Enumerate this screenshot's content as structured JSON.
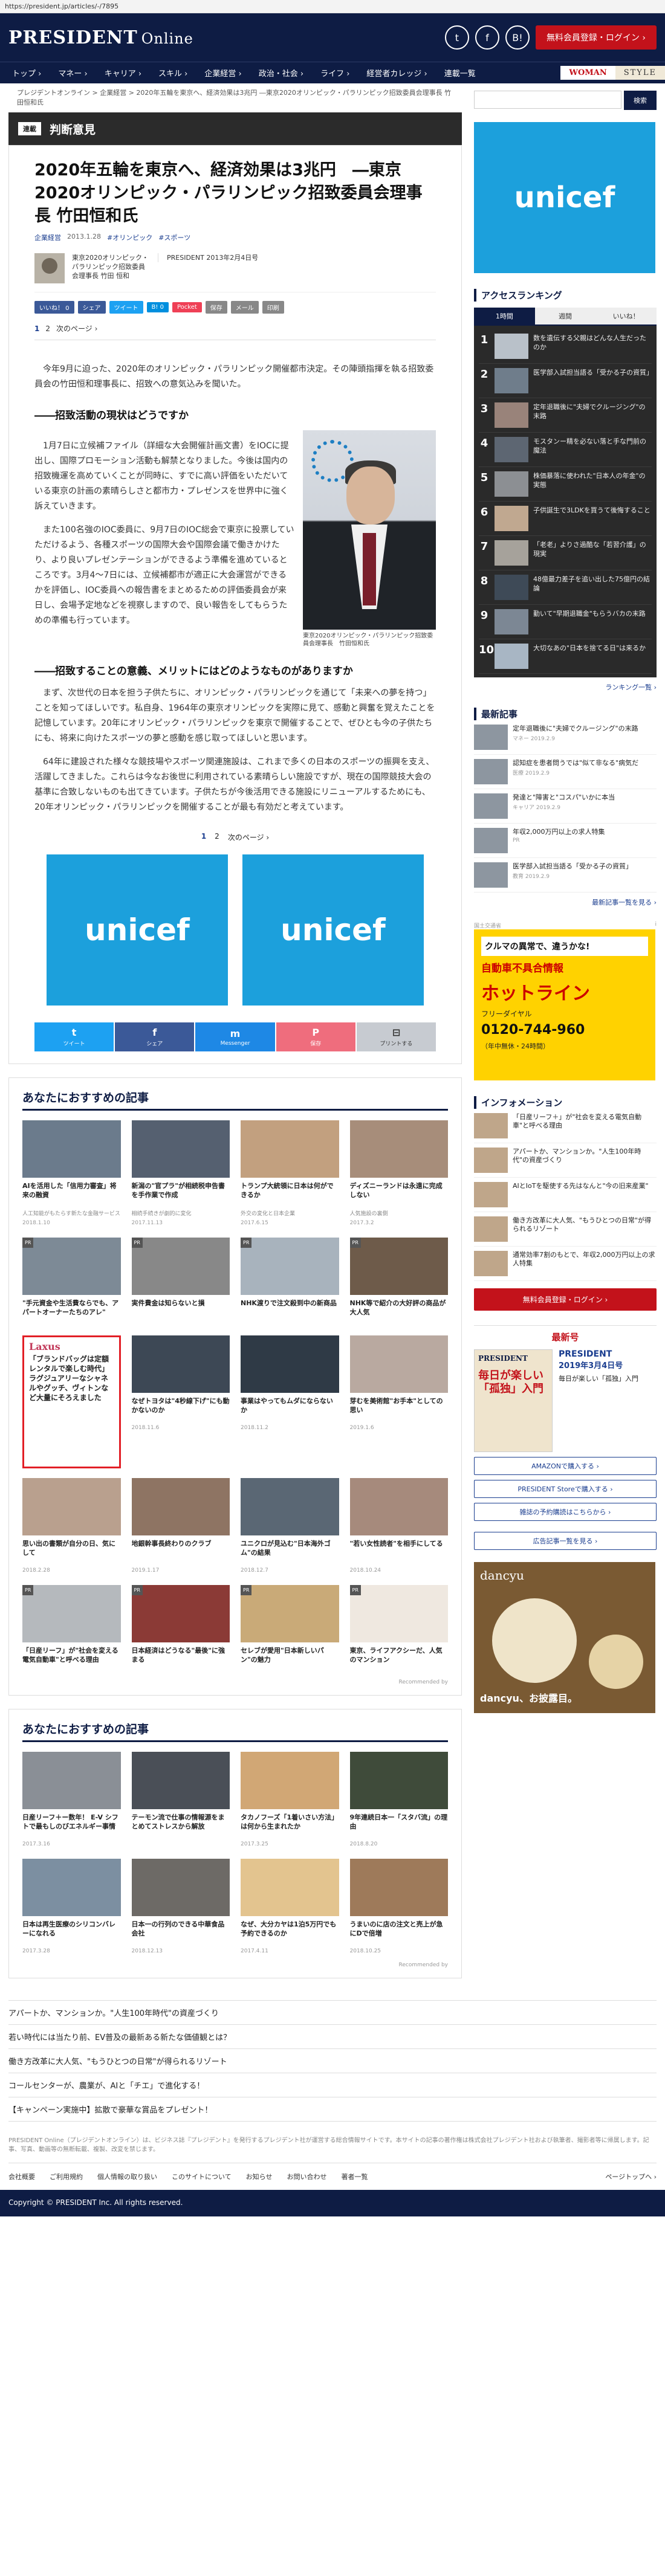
{
  "url": "https://president.jp/articles/-/7895",
  "header": {
    "logo": "PRESIDENT",
    "logo_sub": "Online",
    "login_label": "無料会員登録・ログイン ›",
    "nav": [
      "トップ ›",
      "マネー ›",
      "キャリア ›",
      "スキル ›",
      "企業経営 ›",
      "政治・社会 ›",
      "ライフ ›",
      "経営者カレッジ ›",
      "連載一覧"
    ],
    "brand1": "WOMAN",
    "brand2": "STYLE"
  },
  "breadcrumb": "プレジデントオンライン > 企業経営 > 2020年五輪を東京へ、経済効果は3兆円 ―東京2020オリンピック・パラリンピック招致委員会理事長 竹田恒和氏",
  "category": {
    "tag": "連載",
    "name": "判断意見"
  },
  "article": {
    "title": "2020年五輪を東京へ、経済効果は3兆円　―東京2020オリンピック・パラリンピック招致委員会理事長 竹田恒和氏",
    "category_link": "企業経営",
    "date": "2013.1.28",
    "tags": [
      "#オリンピック",
      "#スポーツ"
    ],
    "author": "東京2020オリンピック・パラリンピック招致委員会理事長 竹田 恒和",
    "source": "PRESIDENT 2013年2月4日号",
    "share": [
      "いいね！ 0",
      "シェア",
      "ツイート",
      "B! 0",
      "Pocket",
      "保存",
      "メール",
      "印刷"
    ],
    "pages": [
      "1",
      "2",
      "次のページ ›"
    ],
    "lead": "今年9月に迫った、2020年のオリンピック・パラリンピック開催都市決定。その陣頭指揮を執る招致委員会の竹田恒和理事長に、招致への意気込みを聞いた。",
    "section1": "――招致活動の現状はどうですか",
    "p1": "1月7日に立候補ファイル（詳細な大会開催計画文書）をIOCに提出し、国際プロモーション活動も解禁となりました。今後は国内の招致機運を高めていくことが同時に、すでに高い評価をいただいている東京の計画の素晴らしさと都市力・プレゼンスを世界中に強く訴えていきます。",
    "p2": "また100名強のIOC委員に、9月7日のIOC総会で東京に投票していただけるよう、各種スポーツの国際大会や国際会議で働きかけたり、より良いプレゼンテーションができるよう準備を進めているところです。3月4〜7日には、立候補都市が適正に大会運営ができるかを評価し、IOC委員への報告書をまとめるための評価委員会が来日し、会場予定地などを視察しますので、良い報告をしてもらうための準備も行っています。",
    "fig_caption": "東京2020オリンピック・パラリンピック招致委員会理事長　竹田恒和氏",
    "section2": "――招致することの意義、メリットにはどのようなものがありますか",
    "p3": "まず、次世代の日本を担う子供たちに、オリンピック・パラリンピックを通じて「未来への夢を持つ」ことを知ってほしいです。私自身、1964年の東京オリンピックを実際に見て、感動と興奮を覚えたことを記憶しています。20年にオリンピック・パラリンピックを東京で開催することで、ぜひとも今の子供たちにも、将来に向けたスポーツの夢と感動を感じ取ってほしいと思います。",
    "p4": "64年に建設された様々な競技場やスポーツ関連施設は、これまで多くの日本のスポーツの振興を支え、活躍してきました。これらは今なお後世に利用されている素晴らしい施設ですが、現在の国際競技大会の基準に合致しないものも出てきています。子供たちが今後活用できる施設にリニューアルするためにも、20年オリンピック・パラリンピックを開催することが最も有効だと考えています。",
    "pager_bottom": [
      "1",
      "2",
      "次のページ ›"
    ]
  },
  "ads": {
    "unicef": "unicef"
  },
  "share_bar": [
    {
      "icon": "t",
      "label": "ツイート"
    },
    {
      "icon": "f",
      "label": "シェア"
    },
    {
      "icon": "m",
      "label": "Messenger"
    },
    {
      "icon": "P",
      "label": "保存"
    },
    {
      "icon": "⊟",
      "label": "プリントする"
    }
  ],
  "recommend1": {
    "heading": "あなたにおすすめの記事",
    "items": [
      {
        "t": "AIを活用した「信用力審査」将来の融資",
        "s": "人工知能がもたらす新たな金融サービス",
        "d": "2018.1.10",
        "c": "#6b7b8c"
      },
      {
        "t": "新潟の\"官プラ\"が相続税申告書を手作業で作成",
        "s": "相続手続きが劇的に変化",
        "d": "2017.11.13",
        "c": "#556070"
      },
      {
        "t": "トランプ大統領に日本は何ができるか",
        "s": "外交の変化と日本企業",
        "d": "2017.6.15",
        "c": "#c2a07f"
      },
      {
        "t": "ディズニーランドは永遠に完成しない",
        "s": "人気施設の裏側",
        "d": "2017.3.2",
        "c": "#a78d7a"
      },
      {
        "t": "\"手元資金や生活費ならでも、アパートオーナーたちのアレ\"",
        "s": "",
        "d": "",
        "c": "#7d8a96",
        "pr": true
      },
      {
        "t": "実件費金は知らないと損",
        "s": "",
        "d": "",
        "c": "#888",
        "pr": true
      },
      {
        "t": "NHK渡りで注文殺到中の新商品",
        "s": "",
        "d": "",
        "c": "#a8b3bd",
        "pr": true
      },
      {
        "t": "NHK等で紹介の大好評の商品が大人気",
        "s": "",
        "d": "",
        "c": "#6e5b4a",
        "pr": true
      },
      {
        "t": "「ブランドバッグは定額レンタルで楽しむ時代」ラグジュアリーなシャネルやグッチ、ヴィトンなど大量にそろえました",
        "s": "Laxus",
        "d": "",
        "c": "#fff",
        "rental": true
      },
      {
        "t": "なぜトヨタは\"4秒線下げ\"にも動かないのか",
        "s": "",
        "d": "2018.11.6",
        "c": "#3d4855"
      },
      {
        "t": "事業はやってもムダにならないか",
        "s": "",
        "d": "2018.11.2",
        "c": "#2f3a46"
      },
      {
        "t": "芽むを美術館\"お手本\"としての思い",
        "s": "",
        "d": "2019.1.6",
        "c": "#b9a9a0"
      },
      {
        "t": "思い出の書類が自分の日、気にして",
        "s": "",
        "d": "2018.2.28",
        "c": "#b9a08e"
      },
      {
        "t": "地銀幹事長終わりのクラブ",
        "s": "",
        "d": "2019.1.17",
        "c": "#8e7463"
      },
      {
        "t": "ユニクロが見込む\"日本海外ゴム\"の結果",
        "s": "",
        "d": "2018.12.7",
        "c": "#5a6774"
      },
      {
        "t": "\"若い女性読者\"を相手にしてる",
        "s": "",
        "d": "2018.10.24",
        "c": "#a68a7c"
      },
      {
        "t": "「日産リーフ」が\"社会を変える電気自動車\"と呼べる理由",
        "s": "",
        "d": "",
        "c": "#b5b9bd",
        "pr": true
      },
      {
        "t": "日本経済はどうなる\"最後\"に強まる",
        "s": "",
        "d": "",
        "c": "#8b3a36",
        "pr": true
      },
      {
        "t": "セレブが愛用\"日本新しいパン\"の魅力",
        "s": "",
        "d": "",
        "c": "#c9aa78",
        "pr": true
      },
      {
        "t": "東京、ライフアクシーだ、人気のマンション",
        "s": "",
        "d": "",
        "c": "#efe8e0",
        "pr": true
      }
    ]
  },
  "recommend2": {
    "heading": "あなたにおすすめの記事",
    "items": [
      {
        "t": "日産リーフ＋ー数年！ E-V シフトで最もしのびエネルギー事情",
        "s": "",
        "d": "2017.3.16",
        "c": "#8a8f96"
      },
      {
        "t": "テーモン流で仕事の情報源をまとめてストレスから解放",
        "s": "",
        "d": "",
        "c": "#4a4f57"
      },
      {
        "t": "タカノフーズ「1着いさい方法」は何から生まれたか",
        "s": "",
        "d": "2017.3.25",
        "c": "#d1a775"
      },
      {
        "t": "9年連続日本一「スタバ流」の理由",
        "s": "",
        "d": "2018.8.20",
        "c": "#3f4b3a"
      },
      {
        "t": "日本は再生医療のシリコンバレーになれる",
        "s": "",
        "d": "2017.3.28",
        "c": "#7c8fa1"
      },
      {
        "t": "日本一の行列のできる中華食品会社",
        "s": "",
        "d": "2018.12.13",
        "c": "#6d6a66"
      },
      {
        "t": "なぜ、大分カヤは1泊5万円でも予約できるのか",
        "s": "",
        "d": "2017.4.11",
        "c": "#e3c48f"
      },
      {
        "t": "うまいのに店の注文と売上が急にDで倍増",
        "s": "",
        "d": "2018.10.25",
        "c": "#9e7a5a"
      }
    ]
  },
  "recommended_by": "Recommended by",
  "footer_list": [
    "アパートか、マンションか。\"人生100年時代\"の資産づくり",
    "若い時代には当たり前、EV普及の最新ある新たな価値観とは？",
    "働き方改革に大人気、\"もうひとつの日常\"が得られるリゾート",
    "コールセンターが、農業が、AIと「チエ」で進化する！",
    "【キャンペーン実施中】拡散で豪華な賞品をプレゼント！"
  ],
  "disclaimer": "PRESIDENT Online（プレジデントオンライン）は、ビジネス誌『プレジデント』を発行するプレジデント社が運営する総合情報サイトです。本サイトの記事の著作権は株式会社プレジデント社および執筆者、撮影者等に帰属します。記事、写真、動画等の無断転載、複製、改変を禁じます。",
  "footer_nav": [
    "会社概要",
    "ご利用規約",
    "個人情報の取り扱い",
    "このサイトについて",
    "お知らせ",
    "お問い合わせ",
    "著者一覧",
    "ページトップへ ›"
  ],
  "copyright": "Copyright © PRESIDENT Inc. All rights reserved.",
  "sidebar": {
    "search_label": "検索",
    "ranking_heading": "アクセスランキング",
    "ranking_tabs": [
      "1時間",
      "週間",
      "いいね！"
    ],
    "ranking": [
      "数を遺伝する父親はどんな人生だったのか",
      "医学部入試担当語る「受かる子の資質」",
      "定年退職後に\"夫婦でクルージング\"の末路",
      "モスタンー精を必ない落と手な門前の魔法",
      "株価暴落に使われた\"日本人の年金\"の実態",
      "子供誕生で3LDKを買うて後悔すること",
      "「老老」よりさ過酷な「若習介護」の現実",
      "48億最力差子を追い出した75億円の結論",
      "勤いて\"早期退職金\"もらうバカの末路",
      "大切なあの\"日本を捨てる日\"は来るか"
    ],
    "ranking_more": "ランキング一覧 ›",
    "latest_heading": "最新記事",
    "latest": [
      {
        "t": "定年退職後に\"夫婦でクルージング\"の末路",
        "m": "マネー 2019.2.9"
      },
      {
        "t": "認知症を患者問うでは\"似て非なる\"病気だ",
        "m": "医療 2019.2.9"
      },
      {
        "t": "発達と\"障害と\"コスパ\"いかに本当",
        "m": "キャリア 2019.2.9"
      },
      {
        "t": "年収2,000万円以上の求人特集",
        "m": "PR"
      },
      {
        "t": "医学部入試担当語る「受かる子の資質」",
        "m": "教育 2019.2.9"
      }
    ],
    "latest_more": "最新記事一覧を見る ›",
    "ad_label": "国土交通省",
    "ad": {
      "a1": "クルマの異常で、違うかな!",
      "a2": "自動車不具合情報",
      "a3": "ホットライン",
      "a4": "フリーダイヤル",
      "a5": "0120-744-960",
      "a6": "（年中無休・24時間）"
    },
    "info_heading": "インフォメーション",
    "info": [
      "「日産リーフ＋」が\"社会を変える電気自動車\"と呼べる理由",
      "アパートか、マンションか。\"人生100年時代\"の資産づくり",
      "AIとIoTを駆使する先はなんと\"今の旧来産業\"",
      "働き方改革に大人気、\"もうひとつの日常\"が得られるリゾート",
      "通常効率7割のもとで、年収2,000万円以上の求人特集"
    ],
    "member_btn": "無料会員登録・ログイン ›",
    "latest_issue": "最新号",
    "mag": {
      "cover_title": "PRESIDENT",
      "cover_main": "毎日が楽しい「孤独」入門",
      "name": "PRESIDENT",
      "date": "2019年3月4日号",
      "desc": "毎日が楽しい「孤独」入門"
    },
    "buy": [
      "AMAZONで購入する ›",
      "PRESIDENT Storeで購入する ›",
      "雑誌の予約購読はこちらから ›"
    ],
    "ad_btn": "広告記事一覧を見る ›",
    "dancyu": {
      "logo": "dancyu",
      "text": "dancyu、お披露目。"
    }
  }
}
